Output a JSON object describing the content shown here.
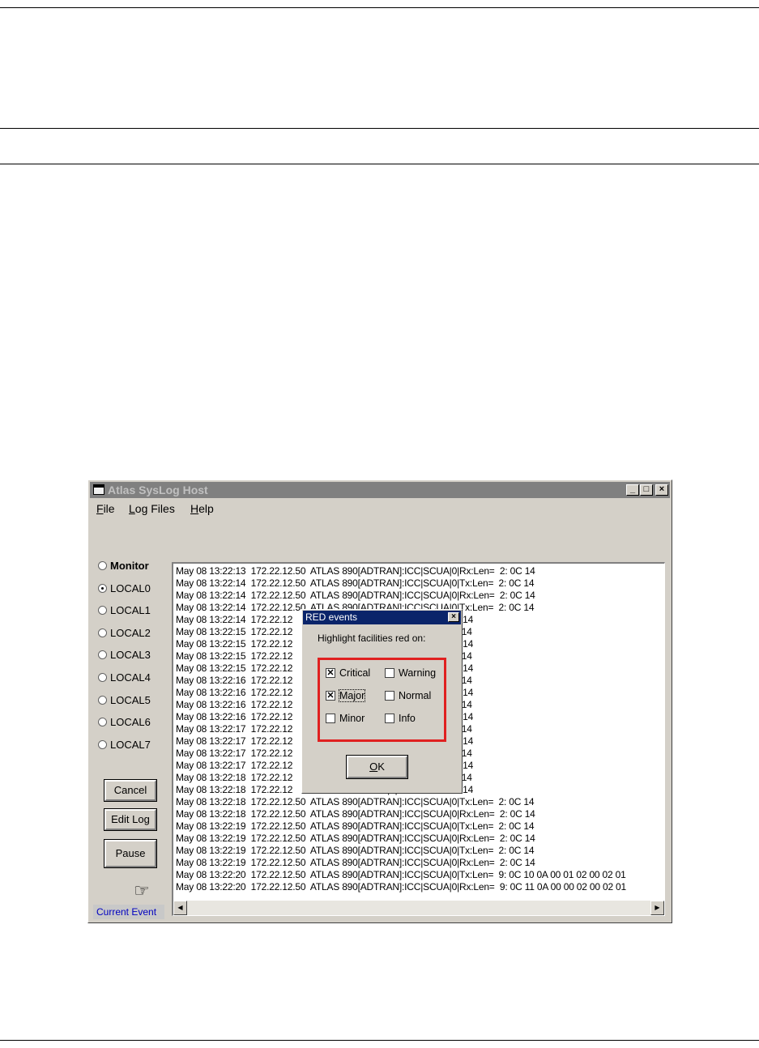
{
  "window": {
    "title": "Atlas SysLog Host",
    "min_glyph": "_",
    "max_glyph": "□",
    "close_glyph": "×"
  },
  "menu": [
    "File",
    "Log Files",
    "Help"
  ],
  "facilities": [
    {
      "label": "Monitor",
      "selected": false
    },
    {
      "label": "LOCAL0",
      "selected": true
    },
    {
      "label": "LOCAL1",
      "selected": false
    },
    {
      "label": "LOCAL2",
      "selected": false
    },
    {
      "label": "LOCAL3",
      "selected": false
    },
    {
      "label": "LOCAL4",
      "selected": false
    },
    {
      "label": "LOCAL5",
      "selected": false
    },
    {
      "label": "LOCAL6",
      "selected": false
    },
    {
      "label": "LOCAL7",
      "selected": false
    }
  ],
  "buttons": {
    "cancel": "Cancel",
    "edit_log": "Edit Log",
    "pause": "Pause"
  },
  "pointer_icon": "pointing-hand-icon",
  "pointer_glyph": "☞",
  "status": "Current Event",
  "log_lines": [
    "May 08 13:22:13  172.22.12.50  ATLAS 890[ADTRAN]:ICC|SCUA|0|Rx:Len=  2: 0C 14",
    "May 08 13:22:14  172.22.12.50  ATLAS 890[ADTRAN]:ICC|SCUA|0|Tx:Len=  2: 0C 14",
    "May 08 13:22:14  172.22.12.50  ATLAS 890[ADTRAN]:ICC|SCUA|0|Rx:Len=  2: 0C 14",
    "May 08 13:22:14  172.22.12.50  ATLAS 890[ADTRAN]:ICC|SCUA|0|Tx:Len=  2: 0C 14",
    "May 08 13:22:14  172.22.12                                   A|0|Rx:Len=  2: 0C 14",
    "May 08 13:22:15  172.22.12                                   A|0|Tx:Len=  2: 0C 14",
    "May 08 13:22:15  172.22.12                                   A|0|Rx:Len=  2: 0C 14",
    "May 08 13:22:15  172.22.12                                   A|0|Tx:Len=  2: 0C 14",
    "May 08 13:22:15  172.22.12                                   A|0|Rx:Len=  2: 0C 14",
    "May 08 13:22:16  172.22.12                                   A|0|Tx:Len=  2: 0C 14",
    "May 08 13:22:16  172.22.12                                   A|0|Rx:Len=  2: 0C 14",
    "May 08 13:22:16  172.22.12                                   A|0|Tx:Len=  2: 0C 14",
    "May 08 13:22:16  172.22.12                                   A|0|Rx:Len=  2: 0C 14",
    "May 08 13:22:17  172.22.12                                   A|0|Tx:Len=  2: 0C 14",
    "May 08 13:22:17  172.22.12                                   A|0|Rx:Len=  2: 0C 14",
    "May 08 13:22:17  172.22.12                                   A|0|Tx:Len=  2: 0C 14",
    "May 08 13:22:17  172.22.12                                   A|0|Rx:Len=  2: 0C 14",
    "May 08 13:22:18  172.22.12                                   A|0|Tx:Len=  2: 0C 14",
    "May 08 13:22:18  172.22.12                                   A|0|Rx:Len=  2: 0C 14",
    "May 08 13:22:18  172.22.12.50  ATLAS 890[ADTRAN]:ICC|SCUA|0|Tx:Len=  2: 0C 14",
    "May 08 13:22:18  172.22.12.50  ATLAS 890[ADTRAN]:ICC|SCUA|0|Rx:Len=  2: 0C 14",
    "May 08 13:22:19  172.22.12.50  ATLAS 890[ADTRAN]:ICC|SCUA|0|Tx:Len=  2: 0C 14",
    "May 08 13:22:19  172.22.12.50  ATLAS 890[ADTRAN]:ICC|SCUA|0|Rx:Len=  2: 0C 14",
    "May 08 13:22:19  172.22.12.50  ATLAS 890[ADTRAN]:ICC|SCUA|0|Tx:Len=  2: 0C 14",
    "May 08 13:22:19  172.22.12.50  ATLAS 890[ADTRAN]:ICC|SCUA|0|Rx:Len=  2: 0C 14",
    "May 08 13:22:20  172.22.12.50  ATLAS 890[ADTRAN]:ICC|SCUA|0|Tx:Len=  9: 0C 10 0A 00 01 02 00 02 01",
    "May 08 13:22:20  172.22.12.50  ATLAS 890[ADTRAN]:ICC|SCUA|0|Rx:Len=  9: 0C 11 0A 00 00 02 00 02 01"
  ],
  "scroll": {
    "left_glyph": "◀",
    "right_glyph": "▶"
  },
  "dialog": {
    "title": "RED events",
    "close_glyph": "×",
    "prompt": "Highlight facilities red on:",
    "options": [
      {
        "label": "Critical",
        "checked": true
      },
      {
        "label": "Warning",
        "checked": false
      },
      {
        "label": "Major",
        "checked": true
      },
      {
        "label": "Normal",
        "checked": false
      },
      {
        "label": "Minor",
        "checked": false
      },
      {
        "label": "Info",
        "checked": false
      }
    ],
    "ok": "OK",
    "check_glyph": "✕",
    "highlight_color": "#e02020"
  }
}
